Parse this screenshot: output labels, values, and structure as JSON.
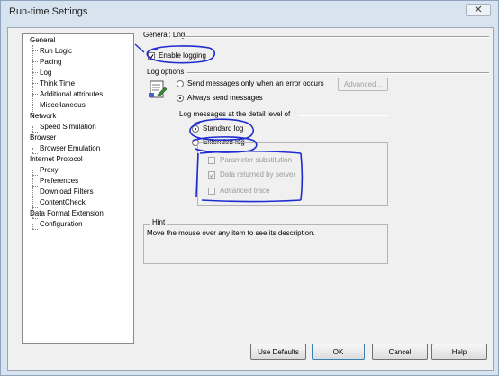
{
  "window": {
    "title": "Run-time Settings"
  },
  "tree": {
    "items": [
      {
        "label": "General"
      },
      {
        "label": "Run Logic"
      },
      {
        "label": "Pacing"
      },
      {
        "label": "Log"
      },
      {
        "label": "Think Time"
      },
      {
        "label": "Additional attributes"
      },
      {
        "label": "Miscellaneous"
      },
      {
        "label": "Network"
      },
      {
        "label": "Speed Simulation"
      },
      {
        "label": "Browser"
      },
      {
        "label": "Browser Emulation"
      },
      {
        "label": "Internet Protocol"
      },
      {
        "label": "Proxy"
      },
      {
        "label": "Preferences"
      },
      {
        "label": "Download Filters"
      },
      {
        "label": "ContentCheck"
      },
      {
        "label": "Data Format Extension"
      },
      {
        "label": "Configuration"
      }
    ]
  },
  "panel": {
    "title": "General: Log",
    "enable_logging": {
      "label": "Enable logging",
      "checked": true
    },
    "log_options": {
      "title": "Log options",
      "send_on_error": {
        "label": "Send messages only when an error occurs",
        "checked": false
      },
      "advanced_button": "Advanced...",
      "always_send": {
        "label": "Always send messages",
        "checked": true
      }
    },
    "detail": {
      "title": "Log messages at the detail level of",
      "standard": {
        "label": "Standard log",
        "checked": true
      },
      "extended": {
        "label": "Extended log",
        "checked": false
      },
      "extended_options": [
        {
          "label": "Parameter substitution",
          "checked": false
        },
        {
          "label": "Data returned by server",
          "checked": true
        },
        {
          "label": "Advanced trace",
          "checked": false
        }
      ]
    },
    "hint": {
      "title": "Hint",
      "text": "Move the mouse over any item to see its description."
    }
  },
  "buttons": {
    "use_defaults": "Use Defaults",
    "ok": "OK",
    "cancel": "Cancel",
    "help": "Help"
  },
  "colors": {
    "annotation": "#1f2ccf",
    "selection": "#3399ff"
  }
}
